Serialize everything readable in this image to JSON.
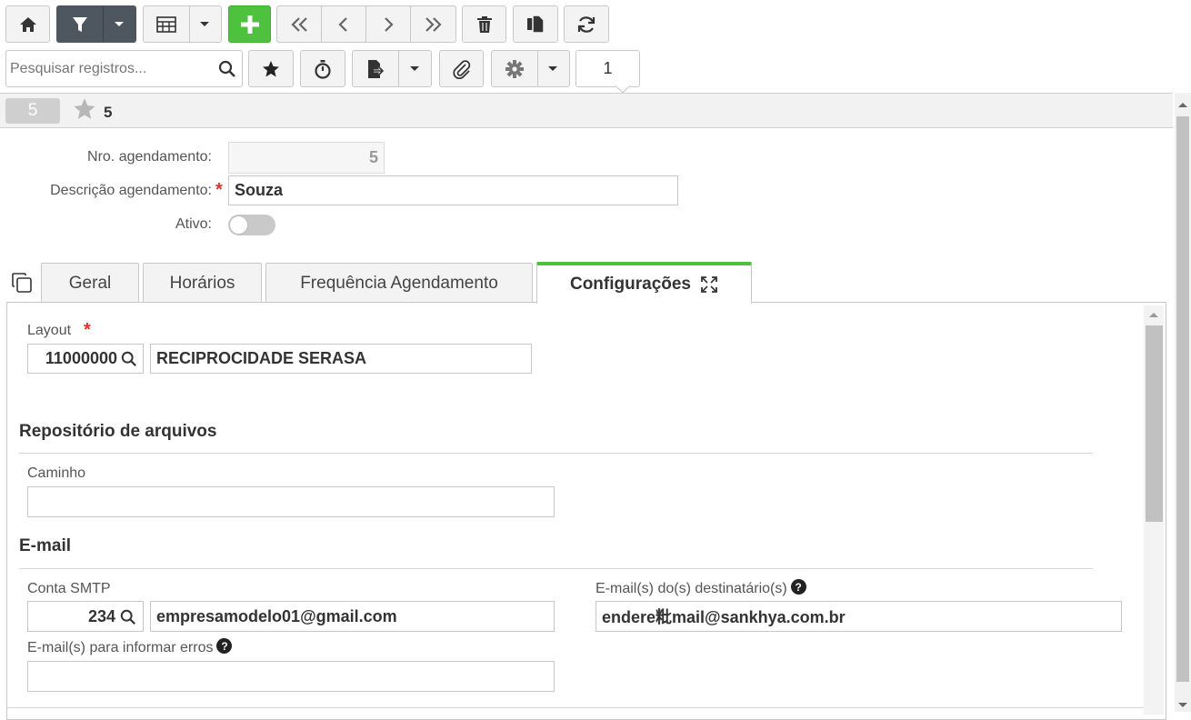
{
  "toolbar": {
    "search_placeholder": "Pesquisar registros...",
    "page_number": "1"
  },
  "record_header": {
    "id_badge": "5",
    "favorite_count": "5"
  },
  "form": {
    "nro_label": "Nro. agendamento:",
    "nro_value": "5",
    "descricao_label": "Descrição agendamento:",
    "descricao_value": "Souza",
    "ativo_label": "Ativo:",
    "required_mark": "*"
  },
  "tabs": [
    {
      "label": "Geral"
    },
    {
      "label": "Horários"
    },
    {
      "label": "Frequência Agendamento"
    },
    {
      "label": "Configurações"
    }
  ],
  "config": {
    "layout_label": "Layout",
    "layout_code": "11000000",
    "layout_name": "RECIPROCIDADE SERASA",
    "repo_title": "Repositório de arquivos",
    "caminho_label": "Caminho",
    "caminho_value": "",
    "email_title": "E-mail",
    "smtp_label": "Conta SMTP",
    "smtp_code": "234",
    "smtp_account": "empresamodelo01@gmail.com",
    "dest_label": "E-mail(s) do(s) destinatário(s)",
    "dest_value": "endere粃mail@sankhya.com.br",
    "errors_label": "E-mail(s) para informar erros",
    "errors_value": "",
    "help_glyph": "?"
  },
  "colors": {
    "accent_green": "#4ec13e",
    "toolbar_dark": "#4e5660",
    "required_red": "#d9362b"
  }
}
